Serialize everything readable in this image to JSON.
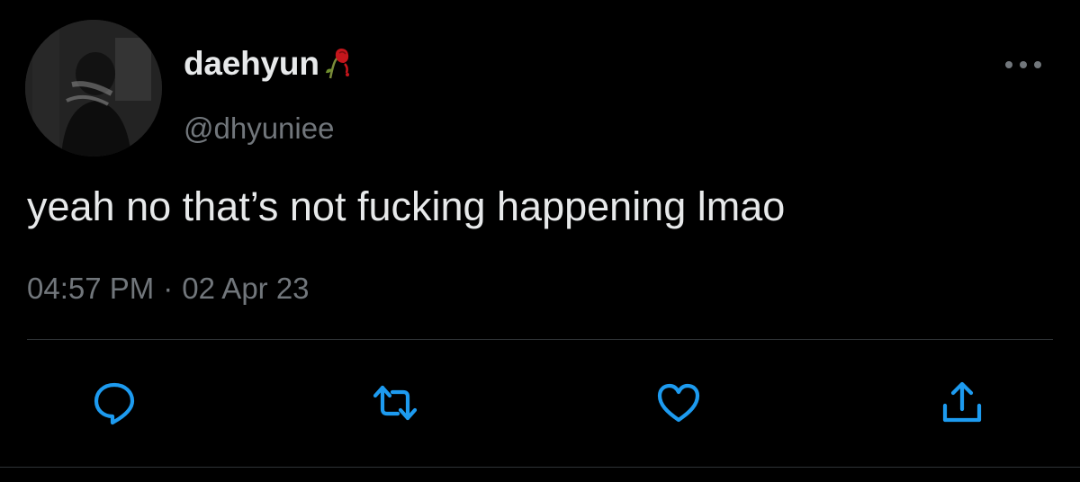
{
  "user": {
    "display_name": "daehyun",
    "handle": "@dhyuniee",
    "name_emoji": "wilted-rose-icon"
  },
  "tweet": {
    "text": "yeah no that’s not fucking happening lmao",
    "time": "04:57 PM",
    "separator": "·",
    "date": "02 Apr 23"
  },
  "icons": {
    "more": "more-icon",
    "reply": "reply-icon",
    "retweet": "retweet-icon",
    "like": "heart-icon",
    "share": "share-icon"
  },
  "colors": {
    "background": "#000000",
    "text_primary": "#e7e9ea",
    "text_secondary": "#71767b",
    "icon": "#1d9bf0",
    "divider": "#2f3336"
  }
}
